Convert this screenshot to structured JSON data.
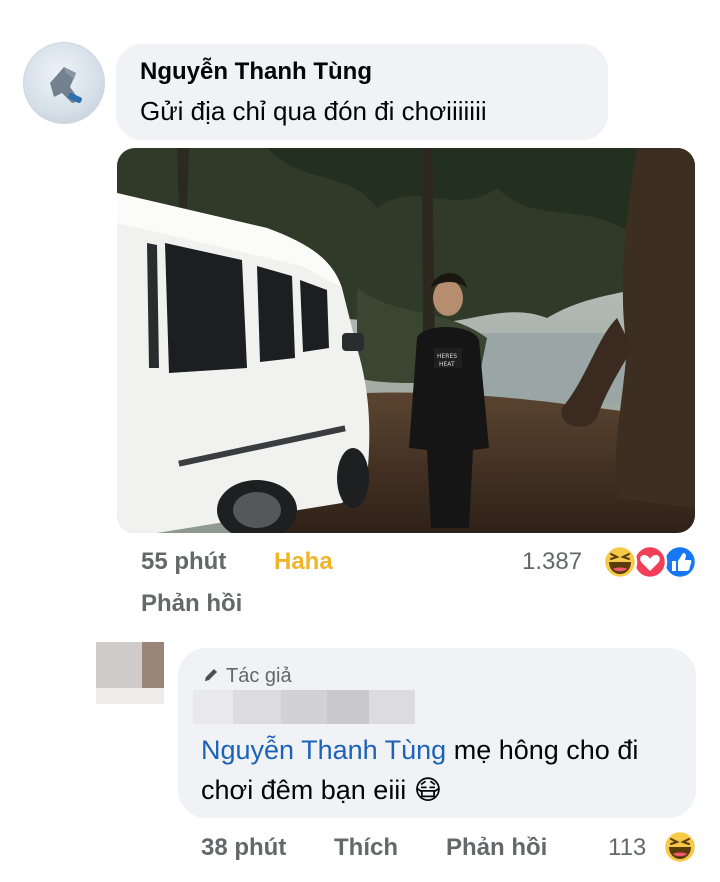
{
  "comment1": {
    "author": "Nguyễn Thanh Tùng",
    "text": "Gửi địa chỉ qua đón đi chơiiiiiii",
    "time": "55 phút",
    "reaction_action": "Haha",
    "reply_label": "Phản hồi",
    "reaction_count": "1.387",
    "reaction_icons": [
      "haha-icon",
      "love-icon",
      "like-icon"
    ],
    "accent_color": "#f0b429"
  },
  "comment2": {
    "author_badge": "Tác giả",
    "mention": "Nguyễn Thanh Tùng",
    "text": " mẹ hông cho đi chơi đêm bạn eiii ",
    "emoji": "😷",
    "time": "38 phút",
    "like_label": "Thích",
    "reply_label": "Phản hồi",
    "reaction_count": "113",
    "reaction_icons": [
      "haha-icon"
    ],
    "mention_color": "#1a63b8"
  }
}
